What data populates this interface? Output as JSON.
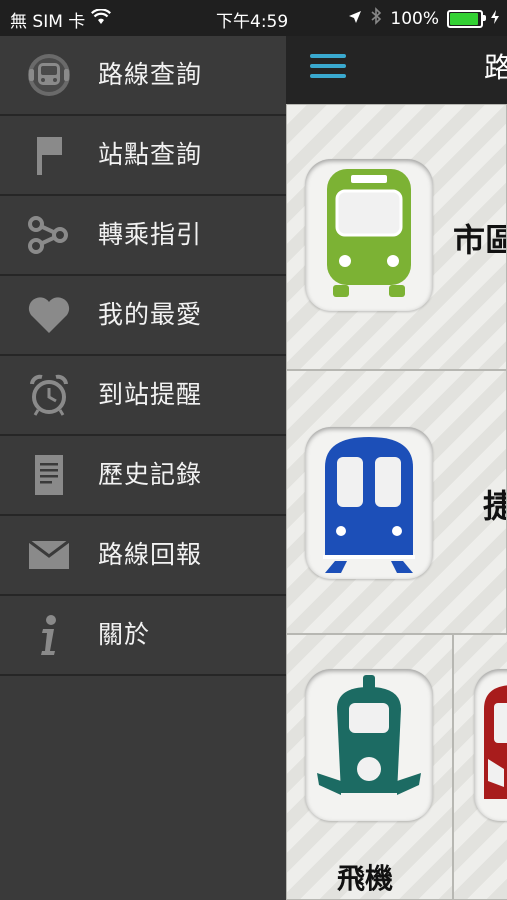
{
  "status_bar": {
    "carrier": "無 SIM 卡",
    "time": "下午4:59",
    "battery": "100%"
  },
  "menu": {
    "items": [
      {
        "label": "路線查詢",
        "icon": "bus-front-icon"
      },
      {
        "label": "站點查詢",
        "icon": "flag-icon"
      },
      {
        "label": "轉乘指引",
        "icon": "share-nodes-icon"
      },
      {
        "label": "我的最愛",
        "icon": "heart-icon"
      },
      {
        "label": "到站提醒",
        "icon": "alarm-clock-icon"
      },
      {
        "label": "歷史記錄",
        "icon": "document-icon"
      },
      {
        "label": "路線回報",
        "icon": "envelope-icon"
      },
      {
        "label": "關於",
        "icon": "info-icon"
      }
    ]
  },
  "header": {
    "title": "路"
  },
  "tiles": [
    {
      "label": "市區",
      "icon": "city-bus-icon",
      "color": "#7cb234"
    },
    {
      "label": "捷",
      "icon": "metro-icon",
      "color": "#1c4fb8"
    },
    {
      "label": "飛機",
      "icon": "airport-shuttle-icon",
      "color": "#1c6b63"
    },
    {
      "label": "",
      "icon": "bus-icon",
      "color": "#a81c1c"
    }
  ]
}
